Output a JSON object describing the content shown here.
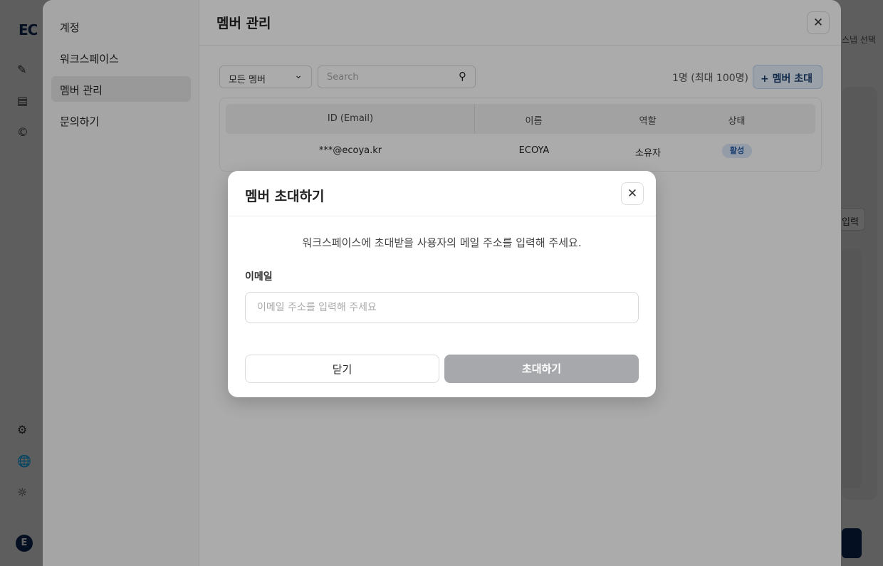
{
  "background": {
    "logo": "EC",
    "right_label": "스냅 선택",
    "right_button": "입력",
    "avatar_initial": "E"
  },
  "settings": {
    "sidebar": {
      "items": [
        {
          "label": "계정"
        },
        {
          "label": "워크스페이스"
        },
        {
          "label": "멤버 관리"
        },
        {
          "label": "문의하기"
        }
      ],
      "active_index": 2
    },
    "title": "멤버 관리",
    "filter": {
      "selected": "모든 멤버"
    },
    "search": {
      "placeholder": "Search"
    },
    "count_text": "1명 (최대 100명)",
    "invite_button": "+ 멤버 초대",
    "table": {
      "columns": [
        "ID (Email)",
        "이름",
        "역할",
        "상태"
      ],
      "rows": [
        {
          "email": "***@ecoya.kr",
          "name": "ECOYA",
          "role": "소유자",
          "status": "활성"
        }
      ]
    }
  },
  "modal": {
    "title": "멤버 초대하기",
    "description": "워크스페이스에 초대받을 사용자의 메일 주소를 입력해 주세요.",
    "field_label": "이메일",
    "email_placeholder": "이메일 주소를 입력해 주세요",
    "email_value": "",
    "close_button": "닫기",
    "invite_button": "초대하기"
  },
  "colors": {
    "primary_navy": "#0c2a5a",
    "invite_button_bg": "#e6f0fb",
    "status_badge_bg": "#dbe9fa",
    "disabled_button": "#a6a8ab"
  }
}
